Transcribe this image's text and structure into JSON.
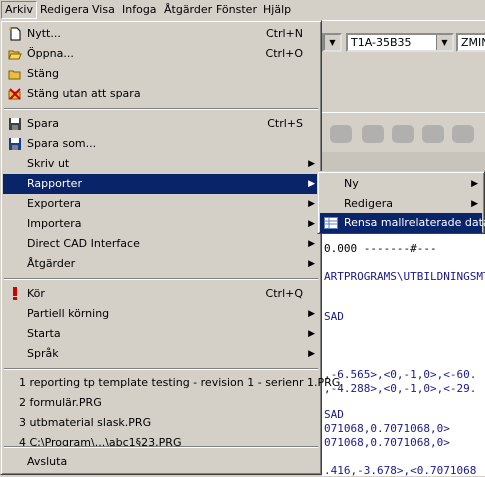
{
  "menubar": {
    "items": [
      "Arkiv",
      "Redigera",
      "Visa",
      "Infoga",
      "Åtgärder",
      "Fönster",
      "Hjälp"
    ]
  },
  "app": {
    "combo_left_value": "",
    "combo_mid_value": "T1A-35B35",
    "combo_right_value": "ZMIN"
  },
  "editor": {
    "lines": [
      "0.000 -------#---",
      "ARTPROGRAMS\\UTBILDNINGSMT",
      "SAD",
      ",-6.565>,<0,-1,0>,<-60.",
      ",-4.288>,<0,-1,0>,<-29.",
      "SAD",
      "071068,0.7071068,0>",
      "071068,0.7071068,0>",
      ".416,-3.678>,<0.7071068"
    ]
  },
  "arkiv_menu": {
    "new": {
      "label": "Nytt...",
      "shortcut": "Ctrl+N"
    },
    "open": {
      "label": "Öppna...",
      "shortcut": "Ctrl+O"
    },
    "close": {
      "label": "Stäng"
    },
    "close_no_save": {
      "label": "Stäng utan att spara"
    },
    "save": {
      "label": "Spara",
      "shortcut": "Ctrl+S"
    },
    "save_as": {
      "label": "Spara som..."
    },
    "print": {
      "label": "Skriv ut"
    },
    "reports": {
      "label": "Rapporter"
    },
    "export": {
      "label": "Exportera"
    },
    "import": {
      "label": "Importera"
    },
    "direct_cad": {
      "label": "Direct CAD Interface"
    },
    "actions": {
      "label": "Åtgärder"
    },
    "run": {
      "label": "Kör",
      "shortcut": "Ctrl+Q"
    },
    "partial_run": {
      "label": "Partiell körning"
    },
    "start": {
      "label": "Starta"
    },
    "language": {
      "label": "Språk"
    },
    "recent_files": [
      "1 reporting tp template testing - revision 1 - serienr 1.PRG",
      "2 formulär.PRG",
      "3 utbmaterial slask.PRG",
      "4 C:\\Program\\...\\abc1§23.PRG"
    ],
    "exit": {
      "label": "Avsluta"
    }
  },
  "reports_submenu": {
    "new": "Ny",
    "edit": "Redigera",
    "clean": "Rensa mallrelaterade data"
  },
  "colors": {
    "highlight": "#0a246a",
    "menu_bg": "#d4d0c8",
    "editor_text": "#1a1a8c"
  }
}
